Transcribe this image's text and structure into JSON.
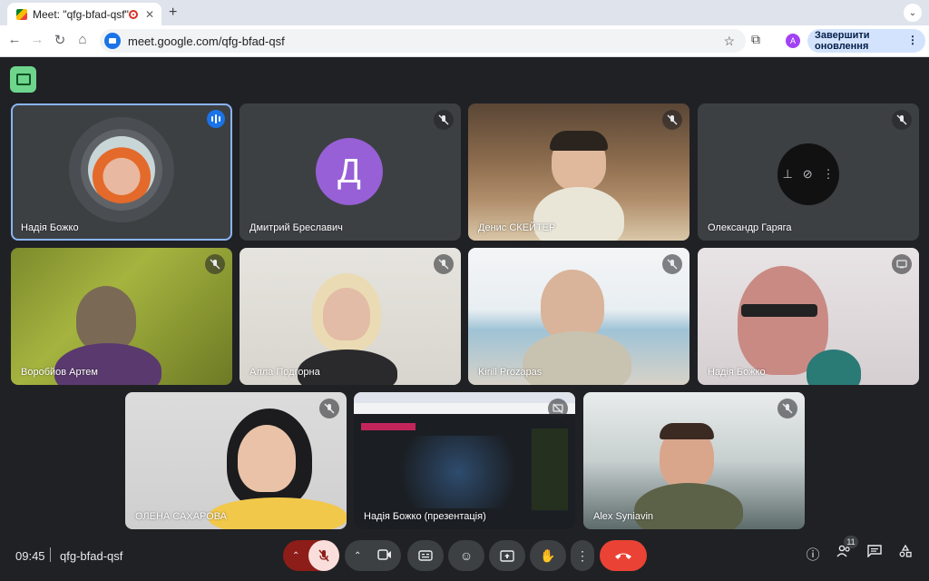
{
  "browser": {
    "tab_title": "Meet: \"qfg-bfad-qsf\"",
    "new_tab": "+",
    "url": "meet.google.com/qfg-bfad-qsf",
    "profile_initial": "A",
    "update_label": "Завершити оновлення"
  },
  "tiles": [
    {
      "name": "Надія Божко",
      "kind": "avatar",
      "status": "speaking"
    },
    {
      "name": "Дмитрий Бреславич",
      "kind": "letter",
      "letter": "Д",
      "status": "muted"
    },
    {
      "name": "Денис СКЕЙТЕР",
      "kind": "video",
      "status": "muted"
    },
    {
      "name": "Олександр Гаряга",
      "kind": "hover",
      "status": "muted"
    },
    {
      "name": "Воробйов Артем",
      "kind": "video",
      "status": "muted"
    },
    {
      "name": "Алла Подгорна",
      "kind": "video",
      "status": "muted"
    },
    {
      "name": "Kirill Prozapas",
      "kind": "video",
      "status": "muted"
    },
    {
      "name": "Надія Божко",
      "kind": "video",
      "status": "presenting-device"
    },
    {
      "name": "ОЛЕНА САХАРОВА",
      "kind": "video",
      "status": "muted"
    },
    {
      "name": "Надія Божко (презентація)",
      "kind": "screen",
      "status": "presentation"
    },
    {
      "name": "Alex Syniavin",
      "kind": "video",
      "status": "muted"
    }
  ],
  "meeting": {
    "time": "09:45",
    "code": "qfg-bfad-qsf",
    "participants_count": "11"
  },
  "colors": {
    "background": "#202124",
    "tile": "#3c4043",
    "active_outline": "#8ab4f8",
    "hangup": "#ea4335",
    "mic_off": "#8c1d18"
  }
}
